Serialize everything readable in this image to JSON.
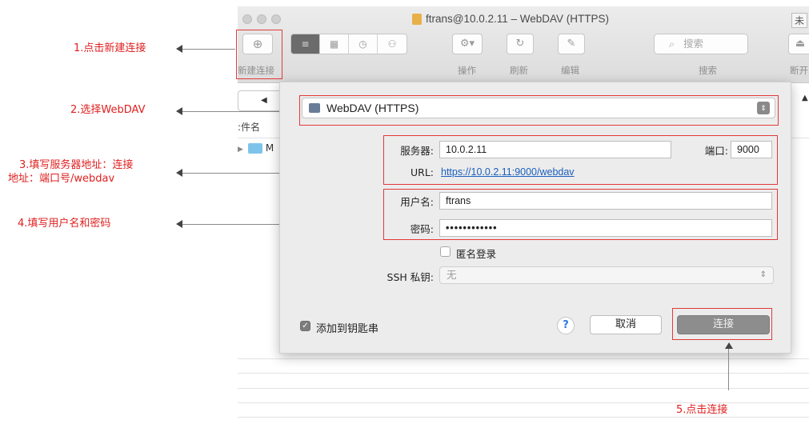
{
  "annotations": {
    "step1": "1.点击新建连接",
    "step2": "2.选择WebDAV",
    "step3_line1": "3.填写服务器地址：连接",
    "step3_line2": "地址：端口号/webdav",
    "step4": "4.填写用户名和密码",
    "step5": "5.点击连接"
  },
  "window": {
    "title": "ftrans@10.0.2.11 – WebDAV (HTTPS)",
    "right_edge_text": "未"
  },
  "toolbar": {
    "new_connection_label": "新建连接",
    "action_label": "操作",
    "refresh_label": "刷新",
    "edit_label": "编辑",
    "search_placeholder": "搜索",
    "search_label": "搜索",
    "disconnect_label": "断开"
  },
  "browser": {
    "column_header": ":件名",
    "folder_name": "M"
  },
  "dialog": {
    "protocol": "WebDAV (HTTPS)",
    "server_label": "服务器:",
    "server_value": "10.0.2.11",
    "port_label": "端口:",
    "port_value": "9000",
    "url_label": "URL:",
    "url_value": "https://10.0.2.11:9000/webdav",
    "username_label": "用户名:",
    "username_value": "ftrans",
    "password_label": "密码:",
    "password_value": "••••••••••••",
    "anonymous_label": "匿名登录",
    "anonymous_checked": false,
    "ssh_label": "SSH 私钥:",
    "ssh_value": "无",
    "keychain_label": "添加到钥匙串",
    "keychain_checked": true,
    "help_label": "?",
    "cancel_label": "取消",
    "connect_label": "连接"
  },
  "colors": {
    "annotation": "#e02020",
    "highlight_box": "#e23a3a",
    "link": "#1a5fbf"
  }
}
